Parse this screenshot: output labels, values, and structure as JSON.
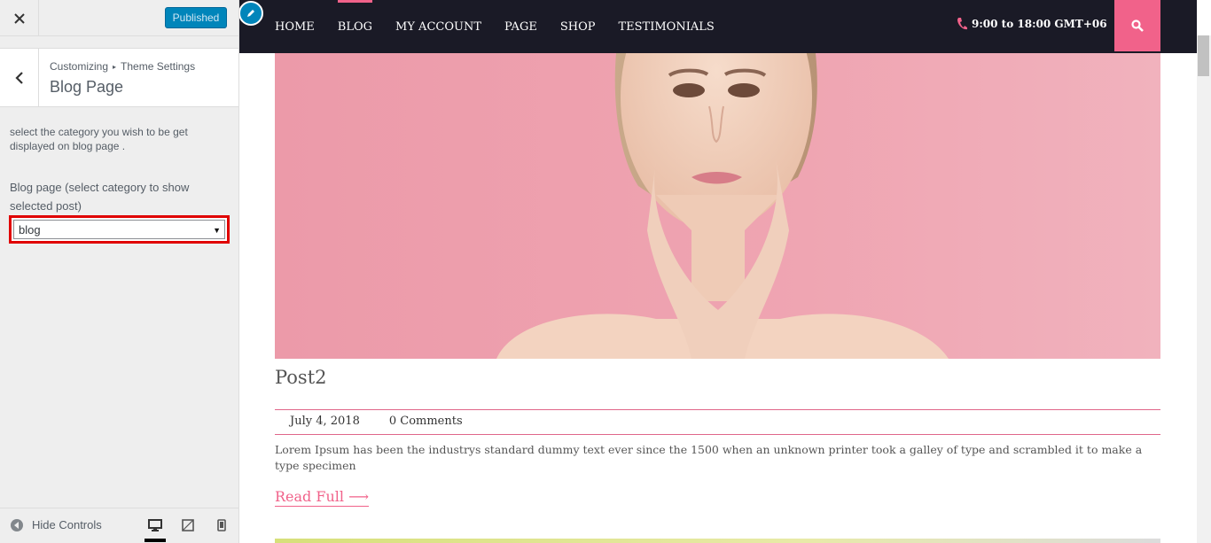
{
  "customizer": {
    "publish_label": "Published",
    "breadcrumb": {
      "root": "Customizing",
      "parent": "Theme Settings"
    },
    "section_title": "Blog Page",
    "description": "select the category you wish to be get displayed on blog page .",
    "control_label": "Blog page (select category to show selected post)",
    "select_value": "blog",
    "footer": {
      "hide_controls_label": "Hide Controls"
    },
    "devices": [
      "desktop-icon",
      "tablet-icon",
      "mobile-icon"
    ],
    "accent": "#0085ba",
    "highlight": "#e00000"
  },
  "site": {
    "menu": [
      {
        "label": "HOME"
      },
      {
        "label": "BLOG"
      },
      {
        "label": "MY ACCOUNT"
      },
      {
        "label": "PAGE"
      },
      {
        "label": "SHOP"
      },
      {
        "label": "TESTIMONIALS"
      }
    ],
    "active_menu": "BLOG",
    "hours": "9:00 to 18:00 GMT+06",
    "accent": "#f1628a",
    "nav_bg": "#1a1a26",
    "post": {
      "title": "Post2",
      "date": "July 4, 2018",
      "comments": "0 Comments",
      "excerpt": "Lorem Ipsum has been the industrys standard dummy text ever since the 1500 when an unknown printer took a galley of type and scrambled it to make a type specimen",
      "read_more": "Read Full"
    }
  }
}
